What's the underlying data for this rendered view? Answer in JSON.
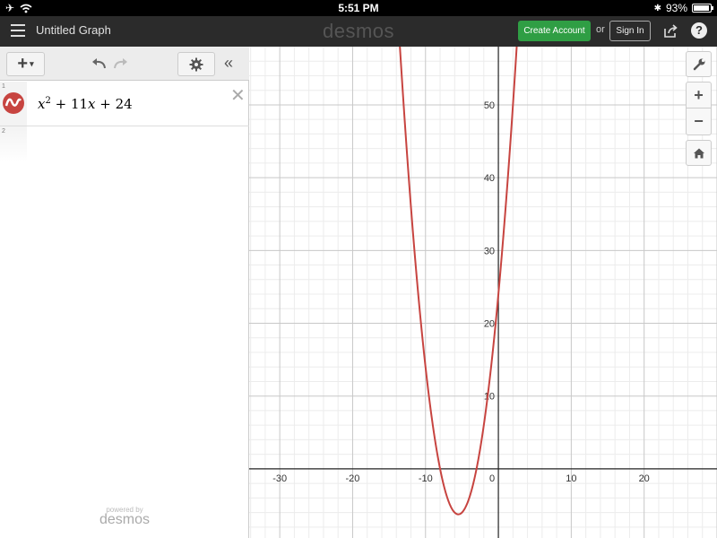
{
  "status_bar": {
    "time": "5:51 PM",
    "battery": "93%",
    "battery_level": 0.93,
    "icons": [
      "airplane-icon",
      "wifi-icon",
      "bluetooth-icon",
      "battery-icon"
    ]
  },
  "header": {
    "menu_icon": "hamburger-icon",
    "title": "Untitled Graph",
    "brand": "desmos",
    "create_account_label": "Create Account",
    "or_label": "or",
    "sign_in_label": "Sign In",
    "share_icon": "share-icon",
    "help_label": "?"
  },
  "toolbar": {
    "add_label": "+",
    "add_caret": "▾",
    "undo_icon": "undo-icon",
    "redo_icon": "redo-icon",
    "settings_icon": "gear-icon",
    "collapse_label": "«"
  },
  "expressions": [
    {
      "index": "1",
      "latex_parts": {
        "x": "x",
        "exp": "2",
        "rest": " + 11",
        "x2": "x",
        "tail": " + 24"
      },
      "color": "#c74440",
      "delete_label": "✕"
    },
    {
      "index": "2"
    }
  ],
  "powered_by": {
    "small": "powered by",
    "brand": "desmos"
  },
  "graph_controls": {
    "wrench_icon": "wrench-icon",
    "zoom_in_label": "+",
    "zoom_out_label": "−",
    "home_icon": "home-icon"
  },
  "chart_data": {
    "type": "line",
    "title": "",
    "function": "x^2 + 11x + 24",
    "series": [
      {
        "name": "x^2 + 11x + 24",
        "color": "#c74440",
        "coefficients": [
          1,
          11,
          24
        ]
      }
    ],
    "xlim": [
      -34.2,
      30.0
    ],
    "ylim": [
      -9.5,
      58.0
    ],
    "x_ticks": [
      -30,
      -20,
      -10,
      0,
      10,
      20
    ],
    "y_ticks": [
      10,
      20,
      30,
      40,
      50
    ],
    "x_tick_labels": [
      "-30",
      "-20",
      "-10",
      "0",
      "10",
      "20"
    ],
    "y_tick_labels": [
      "10",
      "20",
      "30",
      "40",
      "50"
    ],
    "major_grid_step": 10,
    "minor_grid_step": 2,
    "grid": true,
    "xlabel": "",
    "ylabel": ""
  }
}
